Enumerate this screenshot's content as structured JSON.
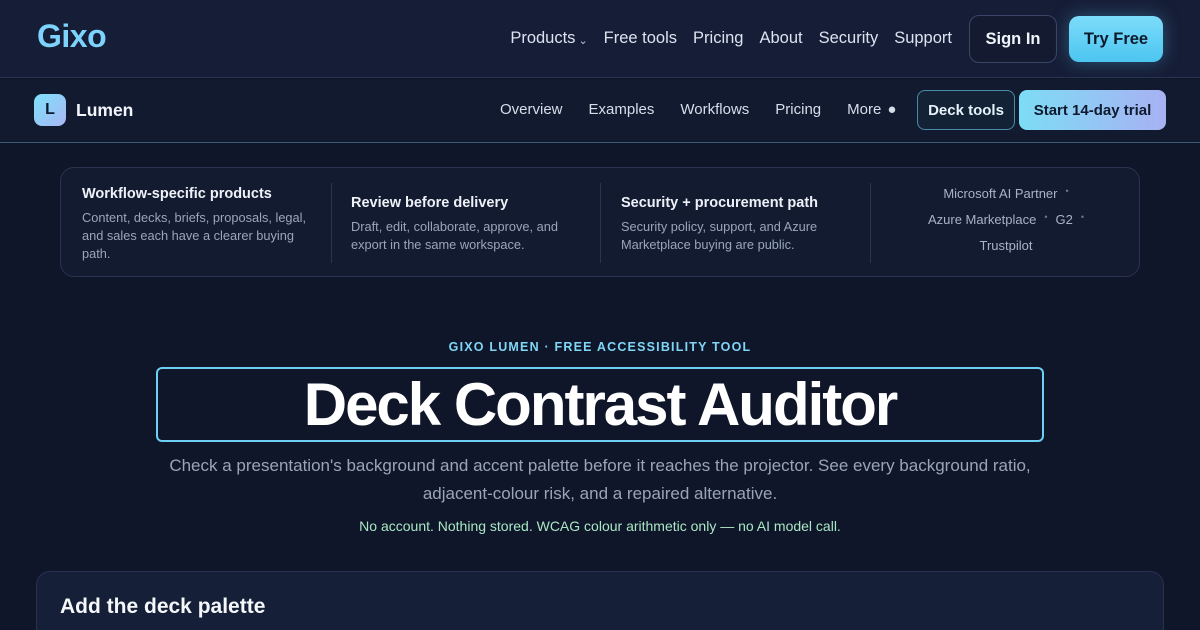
{
  "topnav": {
    "logo": "Gixo",
    "links": [
      "Products",
      "Free tools",
      "Pricing",
      "About",
      "Security",
      "Support"
    ],
    "sign_in": "Sign In",
    "try_free": "Try Free"
  },
  "subnav": {
    "badge_letter": "L",
    "product_name": "Lumen",
    "links": [
      "Overview",
      "Examples",
      "Workflows",
      "Pricing",
      "More"
    ],
    "deck_tools": "Deck tools",
    "trial": "Start 14-day trial"
  },
  "features": [
    {
      "title": "Workflow-specific products",
      "body": "Content, decks, briefs, proposals, legal, and sales each have a clearer buying path."
    },
    {
      "title": "Review before delivery",
      "body": "Draft, edit, collaborate, approve, and export in the same workspace."
    },
    {
      "title": "Security + procurement path",
      "body": "Security policy, support, and Azure Marketplace buying are public."
    }
  ],
  "partners": [
    "Microsoft AI Partner",
    "Azure Marketplace",
    "G2",
    "Trustpilot"
  ],
  "hero": {
    "eyebrow": "GIXO LUMEN · FREE ACCESSIBILITY TOOL",
    "title": "Deck Contrast Auditor",
    "subtitle": "Check a presentation's background and accent palette before it reaches the projector. See every background ratio, adjacent-colour risk, and a repaired alternative.",
    "note": "No account. Nothing stored. WCAG colour arithmetic only — no AI model call."
  },
  "card": {
    "title": "Add the deck palette"
  }
}
